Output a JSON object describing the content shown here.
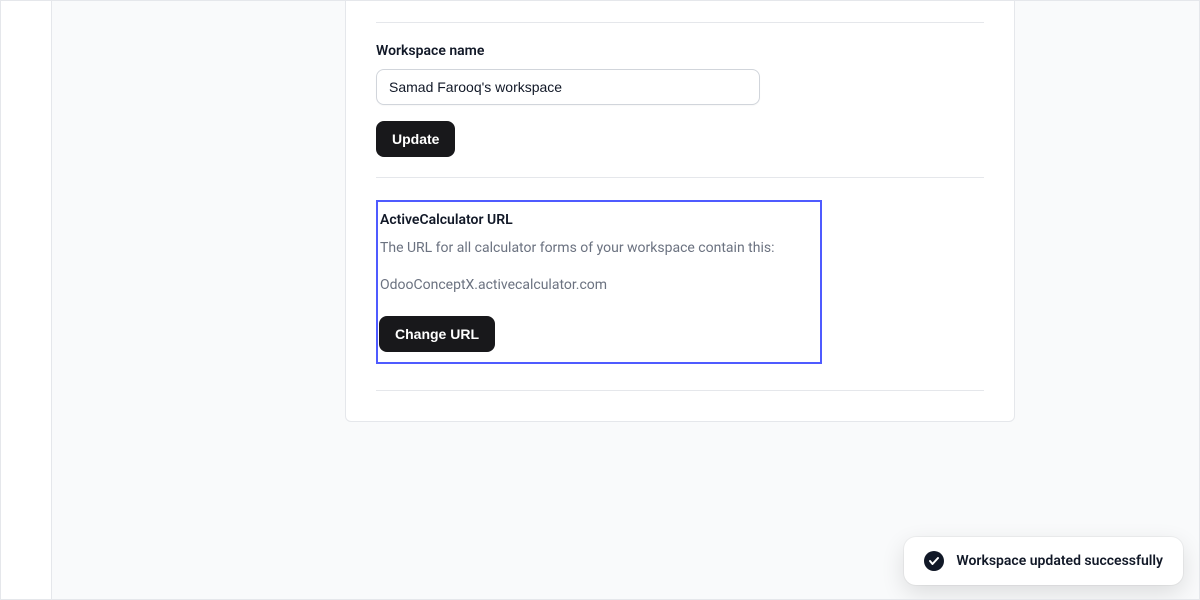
{
  "workspace": {
    "name_label": "Workspace name",
    "name_value": "Samad Farooq's workspace",
    "update_label": "Update"
  },
  "url_section": {
    "title": "ActiveCalculator URL",
    "description": "The URL for all calculator forms of your workspace contain this:",
    "value": "OdooConceptX.activecalculator.com",
    "change_label": "Change URL"
  },
  "toast": {
    "message": "Workspace updated successfully"
  }
}
